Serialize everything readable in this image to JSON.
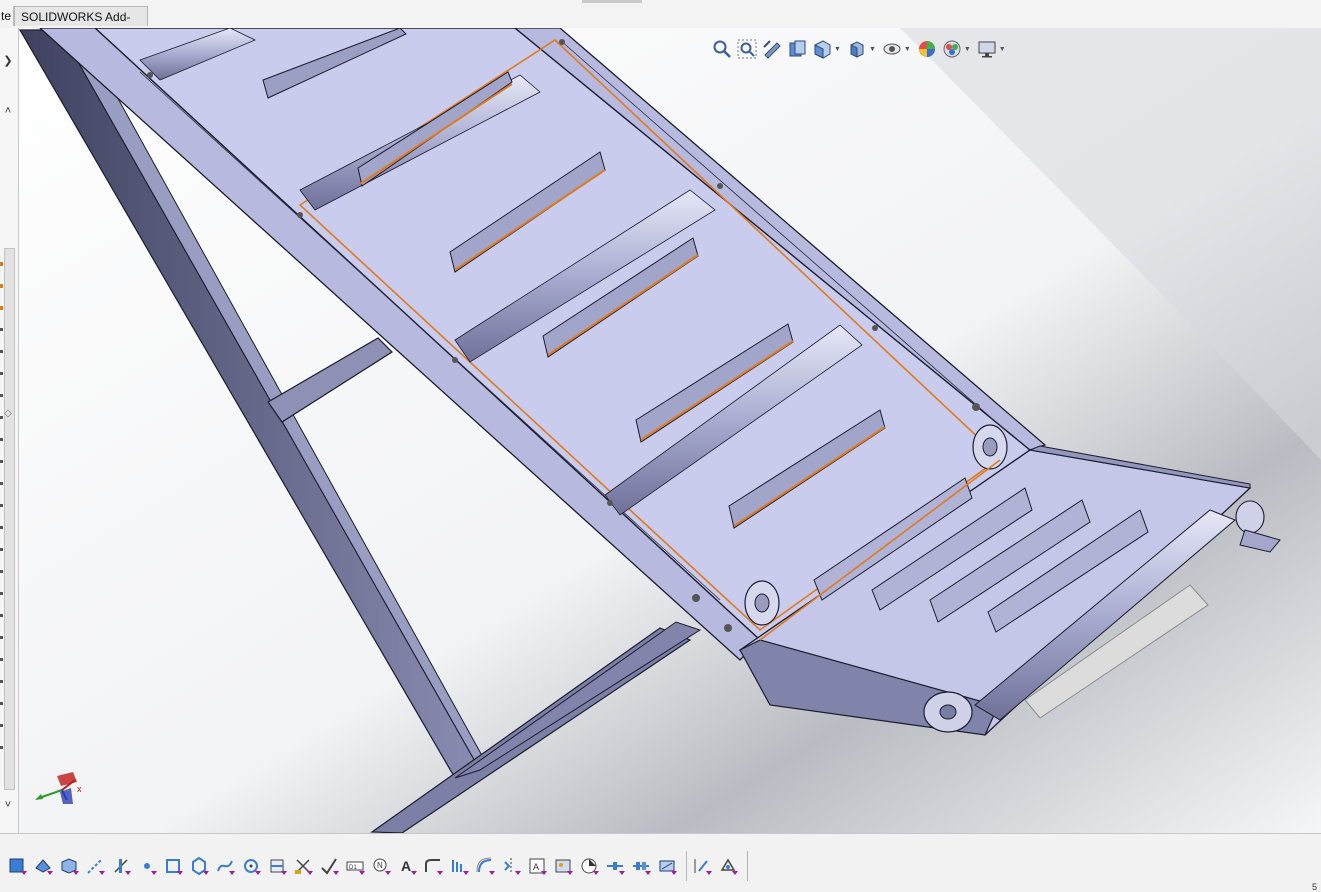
{
  "tabs": {
    "cut_label": "te",
    "addins_label": "SOLIDWORKS Add-Ins"
  },
  "heads_up_toolbar": [
    {
      "icon": "zoom-to-fit-icon",
      "dropdown": false
    },
    {
      "icon": "zoom-to-area-icon",
      "dropdown": false
    },
    {
      "icon": "previous-view-icon",
      "dropdown": false
    },
    {
      "icon": "section-view-icon",
      "dropdown": false
    },
    {
      "icon": "view-orientation-icon",
      "dropdown": true
    },
    {
      "icon": "display-style-icon",
      "dropdown": true
    },
    {
      "icon": "hide-show-items-icon",
      "dropdown": true
    },
    {
      "icon": "edit-appearance-icon",
      "dropdown": false
    },
    {
      "icon": "apply-scene-icon",
      "dropdown": true
    },
    {
      "icon": "view-settings-icon",
      "dropdown": true
    }
  ],
  "sketch_toolbar_icons": [
    "sketch-icon",
    "smart-dimension-icon",
    "3d-sketch-icon",
    "line-icon",
    "centerline-icon",
    "point-icon",
    "corner-rectangle-icon",
    "polygon-icon",
    "spline-icon",
    "circle-icon",
    "convert-entities-icon",
    "trim-icon",
    "relations-icon",
    "dimension-icon",
    "note-icon",
    "text-icon",
    "sketch-fillet-icon",
    "linear-pattern-icon",
    "offset-icon",
    "mirror-icon",
    "block-icon",
    "insert-picture-icon",
    "sketch-picture-icon",
    "move-entities-icon",
    "copy-entities-icon",
    "rotate-icon",
    "scale-icon",
    "stretch-icon"
  ],
  "corner_text": "5",
  "colors": {
    "part_face": "#c8cbec",
    "part_edge": "#1c1c2e",
    "frame_dark": "#5a5c80",
    "belt_edge_highlight": "#e07a1e",
    "toolbar_bg": "#f2f2f2",
    "arrow_accent": "#a01ca0"
  }
}
